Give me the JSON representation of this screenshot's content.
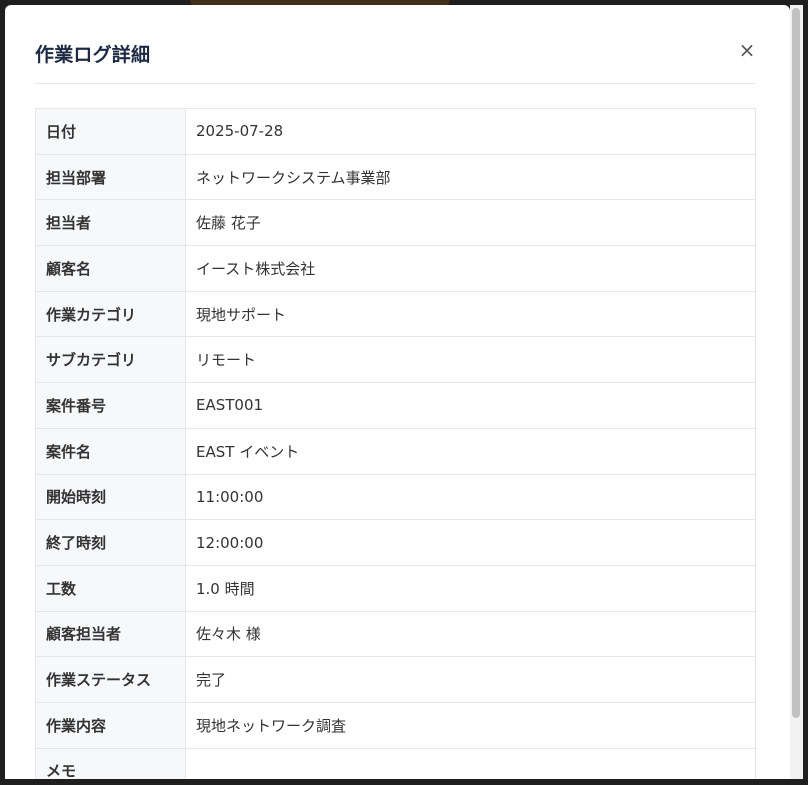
{
  "modal": {
    "title": "作業ログ詳細",
    "close_label": "×"
  },
  "detail_rows": [
    {
      "label": "日付",
      "value": "2025-07-28"
    },
    {
      "label": "担当部署",
      "value": "ネットワークシステム事業部"
    },
    {
      "label": "担当者",
      "value": "佐藤 花子"
    },
    {
      "label": "顧客名",
      "value": "イースト株式会社"
    },
    {
      "label": "作業カテゴリ",
      "value": "現地サポート"
    },
    {
      "label": "サブカテゴリ",
      "value": "リモート"
    },
    {
      "label": "案件番号",
      "value": "EAST001"
    },
    {
      "label": "案件名",
      "value": "EAST イベント"
    },
    {
      "label": "開始時刻",
      "value": "11:00:00"
    },
    {
      "label": "終了時刻",
      "value": "12:00:00"
    },
    {
      "label": "工数",
      "value": "1.0 時間"
    },
    {
      "label": "顧客担当者",
      "value": "佐々木 様"
    },
    {
      "label": "作業ステータス",
      "value": "完了"
    },
    {
      "label": "作業内容",
      "value": "現地ネットワーク調査"
    },
    {
      "label": "メモ",
      "value": ""
    }
  ]
}
